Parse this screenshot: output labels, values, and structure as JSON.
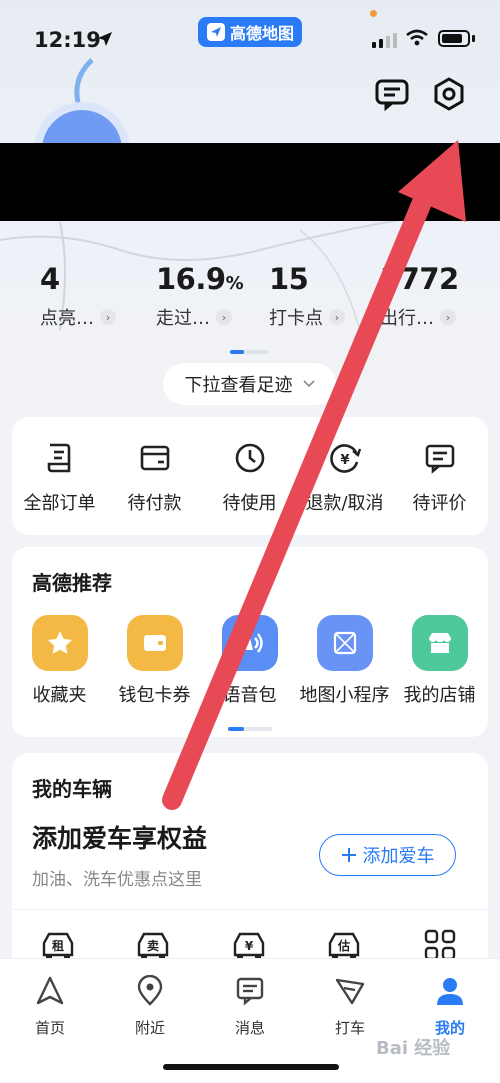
{
  "status_bar": {
    "time": "12:19",
    "app_pill": "高德地图"
  },
  "stats": [
    {
      "value": "4",
      "suffix": "",
      "label": "点亮…"
    },
    {
      "value": "16.9",
      "suffix": "%",
      "label": "走过…"
    },
    {
      "value": "15",
      "suffix": "",
      "label": "打卡点"
    },
    {
      "value": "3772",
      "suffix": "",
      "label": "出行…"
    }
  ],
  "pull_hint": "下拉查看足迹",
  "orders": [
    {
      "label": "全部订单",
      "icon": "receipt-icon"
    },
    {
      "label": "待付款",
      "icon": "wallet-icon"
    },
    {
      "label": "待使用",
      "icon": "clock-icon"
    },
    {
      "label": "退款/取消",
      "icon": "refund-icon"
    },
    {
      "label": "待评价",
      "icon": "comment-icon"
    }
  ],
  "recommend": {
    "title": "高德推荐",
    "items": [
      {
        "label": "收藏夹",
        "icon": "star-icon",
        "color": "#f4b944"
      },
      {
        "label": "钱包卡券",
        "icon": "wallet-card-icon",
        "color": "#f4b944"
      },
      {
        "label": "语音包",
        "icon": "voice-icon",
        "color": "#5b8ef5"
      },
      {
        "label": "地图小程序",
        "icon": "mini-program-icon",
        "color": "#6a93f6"
      },
      {
        "label": "我的店铺",
        "icon": "shop-icon",
        "color": "#4dc89a"
      }
    ]
  },
  "vehicle": {
    "title": "我的车辆",
    "headline": "添加爱车享权益",
    "subtitle": "加油、洗车优惠点这里",
    "add_button": "添加爱车",
    "icons": [
      "rent-car-icon",
      "sell-car-icon",
      "car-price-icon",
      "car-estimate-icon",
      "grid-icon"
    ],
    "icon_glyphs": [
      "租",
      "卖",
      "¥",
      "估"
    ]
  },
  "tabs": [
    {
      "label": "首页",
      "icon": "navigation-icon",
      "active": false
    },
    {
      "label": "附近",
      "icon": "location-pin-icon",
      "active": false
    },
    {
      "label": "消息",
      "icon": "message-icon",
      "active": false
    },
    {
      "label": "打车",
      "icon": "taxi-icon",
      "active": false
    },
    {
      "label": "我的",
      "icon": "user-icon",
      "active": true
    }
  ],
  "watermark": "Bai 经验",
  "colors": {
    "accent": "#2a7bf5",
    "annotation_arrow": "#e84a55"
  }
}
